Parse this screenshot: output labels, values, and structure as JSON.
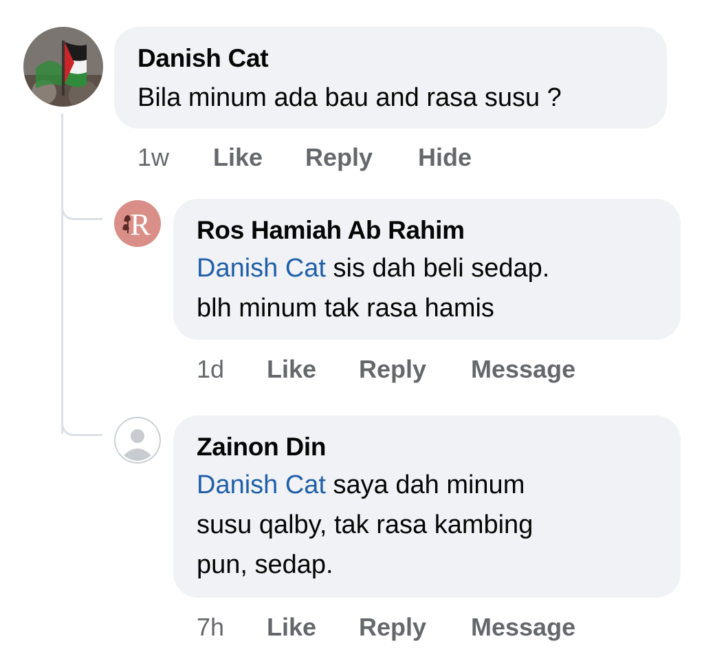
{
  "comments": [
    {
      "author": "Danish Cat",
      "text": "Bila minum ada bau and rasa susu ?",
      "time": "1w",
      "actions": {
        "like": "Like",
        "reply": "Reply",
        "extra": "Hide"
      }
    }
  ],
  "replies": [
    {
      "author": "Ros Hamiah Ab Rahim",
      "mention": "Danish Cat",
      "line1": " sis dah beli sedap.",
      "line2": "blh minum tak rasa hamis",
      "time": "1d",
      "actions": {
        "like": "Like",
        "reply": "Reply",
        "extra": "Message"
      }
    },
    {
      "author": "Zainon Din",
      "mention": "Danish Cat",
      "line1": " saya dah minum",
      "line2": "susu qalby, tak rasa kambing",
      "line3": "pun, sedap.",
      "time": "7h",
      "actions": {
        "like": "Like",
        "reply": "Reply",
        "extra": "Message"
      }
    }
  ],
  "colors": {
    "bubble": "#f0f2f5",
    "mention": "#1f5fa8",
    "meta": "#65676b",
    "thread_line": "#dcdfe4"
  },
  "icons": {
    "danish_avatar": "flag-avatar-icon",
    "ros_avatar": "letter-r-avatar-icon",
    "zainon_avatar": "default-person-avatar-icon"
  }
}
